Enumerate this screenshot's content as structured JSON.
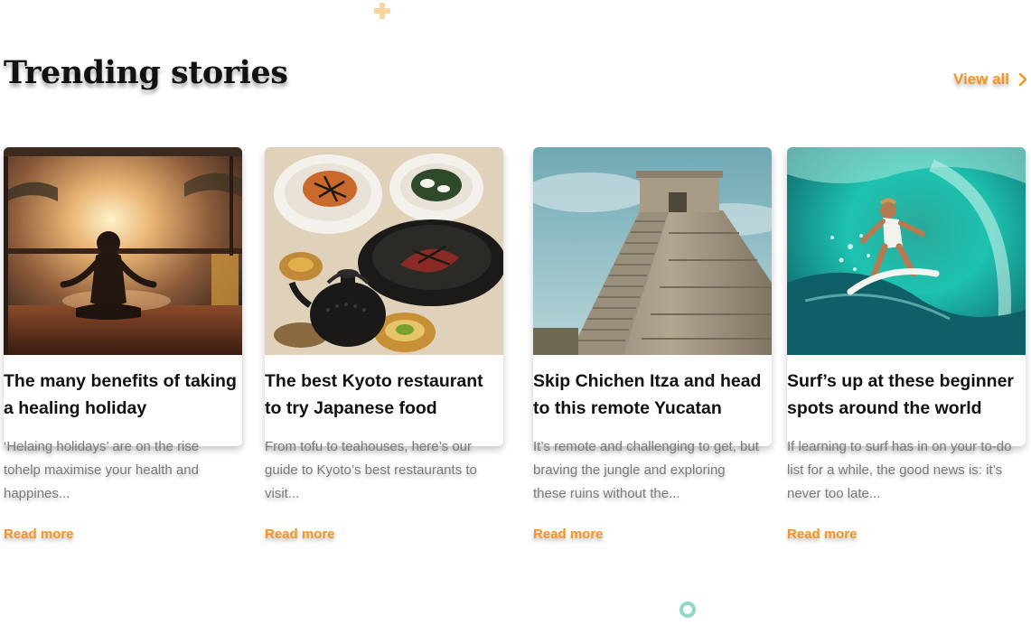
{
  "section": {
    "title": "Trending stories",
    "view_all_label": "View all"
  },
  "accent_color": "#f7931e",
  "cards": [
    {
      "title": "The many benefits of taking a healing holiday",
      "excerpt": "‘Helaing holidays’ are on the rise tohelp maximise your health and happines...",
      "read_more": "Read more",
      "image_icon": "yoga-sunset-photo"
    },
    {
      "title": "The best Kyoto restaurant to try Japanese food",
      "excerpt": "From tofu to teahouses, here’s our guide to Kyoto’s best restaurants to visit...",
      "read_more": "Read more",
      "image_icon": "japanese-food-photo"
    },
    {
      "title": "Skip Chichen Itza and head to this remote Yucatan",
      "excerpt": "It’s remote and challenging to get, but braving the jungle and exploring these ruins without the...",
      "read_more": "Read more",
      "image_icon": "mayan-pyramid-photo"
    },
    {
      "title": "Surf’s up at these beginner spots around the world",
      "excerpt": "If learning to surf has in on your to-do list for a while, the good news is: it’s never too late...",
      "read_more": "Read more",
      "image_icon": "surfer-wave-photo"
    }
  ]
}
